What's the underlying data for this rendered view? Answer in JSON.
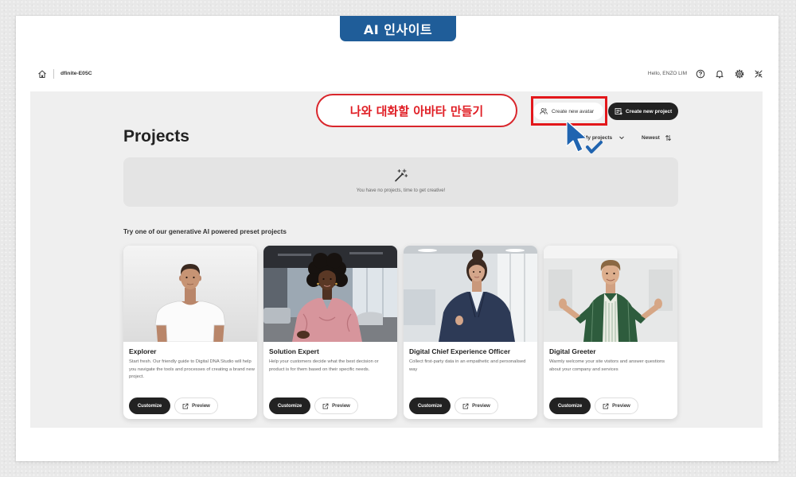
{
  "banner": {
    "label": "AI 인사이트",
    "color": "#1f5d99"
  },
  "topbar": {
    "home_icon": "home-icon",
    "workspace_name": "dfinite-E05C",
    "greeting": "Hello, ENZO LIM",
    "right_icons": [
      "help-icon",
      "bell-icon",
      "gear-icon",
      "collapse-icon"
    ]
  },
  "annotation": {
    "callout_text": "나와 대화할 아바타 만들기",
    "highlight_color": "#e3171b",
    "cursor_icon": "cursor-check-icon"
  },
  "actions": {
    "create_avatar_label": "Create new avatar",
    "create_avatar_icon": "users-icon",
    "create_project_label": "Create new project",
    "create_project_icon": "project-icon"
  },
  "projects": {
    "title": "Projects",
    "filter_label": "My projects",
    "sort_label": "Newest",
    "empty_icon": "magic-wand-icon",
    "empty_message": "You have no projects, time to get creative!"
  },
  "presets": {
    "heading": "Try one of our generative AI powered preset projects",
    "cards": [
      {
        "title": "Explorer",
        "description": "Start fresh. Our friendly guide to Digital DNA Studio will help you navigate the tools and processes of creating a brand new project.",
        "customize_label": "Customize",
        "preview_label": "Preview"
      },
      {
        "title": "Solution Expert",
        "description": "Help your customers decide what the best decision or product is for them based on their specific needs.",
        "customize_label": "Customize",
        "preview_label": "Preview"
      },
      {
        "title": "Digital Chief Experience Officer",
        "description": "Collect first-party data in an empathetic and personalised way",
        "customize_label": "Customize",
        "preview_label": "Preview"
      },
      {
        "title": "Digital Greeter",
        "description": "Warmly welcome your site visitors and answer questions about your company and services",
        "customize_label": "Customize",
        "preview_label": "Preview"
      }
    ]
  },
  "colors": {
    "primary_button": "#222222",
    "content_background": "#efefef",
    "callout_red": "#d9262c",
    "cursor_blue": "#2064b0"
  }
}
